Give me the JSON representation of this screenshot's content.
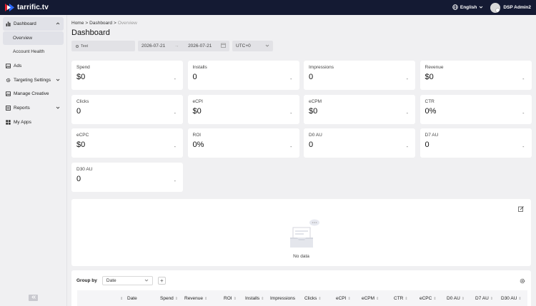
{
  "brand": {
    "name": "tarrific.tv"
  },
  "topbar": {
    "language": "English",
    "user": "DSP Admin2"
  },
  "sidebar": {
    "items": [
      {
        "label": "Dashboard",
        "icon": "bar-chart-icon",
        "expanded": true
      },
      {
        "label": "Overview",
        "sub": true,
        "active": true
      },
      {
        "label": "Account Health",
        "sub": true
      },
      {
        "label": "Ads",
        "icon": "image-icon"
      },
      {
        "label": "Targeting Settings",
        "icon": "gear-icon",
        "expanded": false
      },
      {
        "label": "Manage Creative",
        "icon": "image-icon"
      },
      {
        "label": "Reports",
        "icon": "report-icon",
        "expanded": false
      },
      {
        "label": "My Apps",
        "icon": "apps-icon"
      }
    ]
  },
  "breadcrumb": {
    "home": "Home",
    "dashboard": "Dashboard",
    "current": "Overview"
  },
  "page": {
    "title": "Dashboard"
  },
  "filters": {
    "app": "Test",
    "date_start": "2026-07-21",
    "date_separator": "→",
    "date_end": "2026-07-21",
    "timezone": "UTC+0"
  },
  "metrics": [
    {
      "label": "Spend",
      "value": "$0",
      "change": "-"
    },
    {
      "label": "Installs",
      "value": "0",
      "change": "-"
    },
    {
      "label": "Impressions",
      "value": "0",
      "change": "-"
    },
    {
      "label": "Revenue",
      "value": "$0",
      "change": "-"
    },
    {
      "label": "Clicks",
      "value": "0",
      "change": "-"
    },
    {
      "label": "eCPI",
      "value": "$0",
      "change": "-"
    },
    {
      "label": "eCPM",
      "value": "$0",
      "change": "-"
    },
    {
      "label": "CTR",
      "value": "0%",
      "change": "-"
    },
    {
      "label": "eCPC",
      "value": "$0",
      "change": "-"
    },
    {
      "label": "ROI",
      "value": "0%",
      "change": "-"
    },
    {
      "label": "D0 AU",
      "value": "0",
      "change": "-"
    },
    {
      "label": "D7 AU",
      "value": "0",
      "change": "-"
    },
    {
      "label": "D30 AU",
      "value": "0",
      "change": "-"
    }
  ],
  "chart_panel": {
    "empty_text": "No data"
  },
  "table": {
    "group_by_label": "Group by",
    "group_by_value": "Date",
    "columns": [
      "Date",
      "Spend",
      "Revenue",
      "ROI",
      "Installs",
      "Impressions",
      "Clicks",
      "eCPI",
      "eCPM",
      "CTR",
      "eCPC",
      "D0 AU",
      "D7 AU",
      "D30 AU"
    ]
  },
  "colors": {
    "topbar": "#141a33",
    "accent_red": "#e5202e",
    "accent_blue": "#2f6bff"
  }
}
